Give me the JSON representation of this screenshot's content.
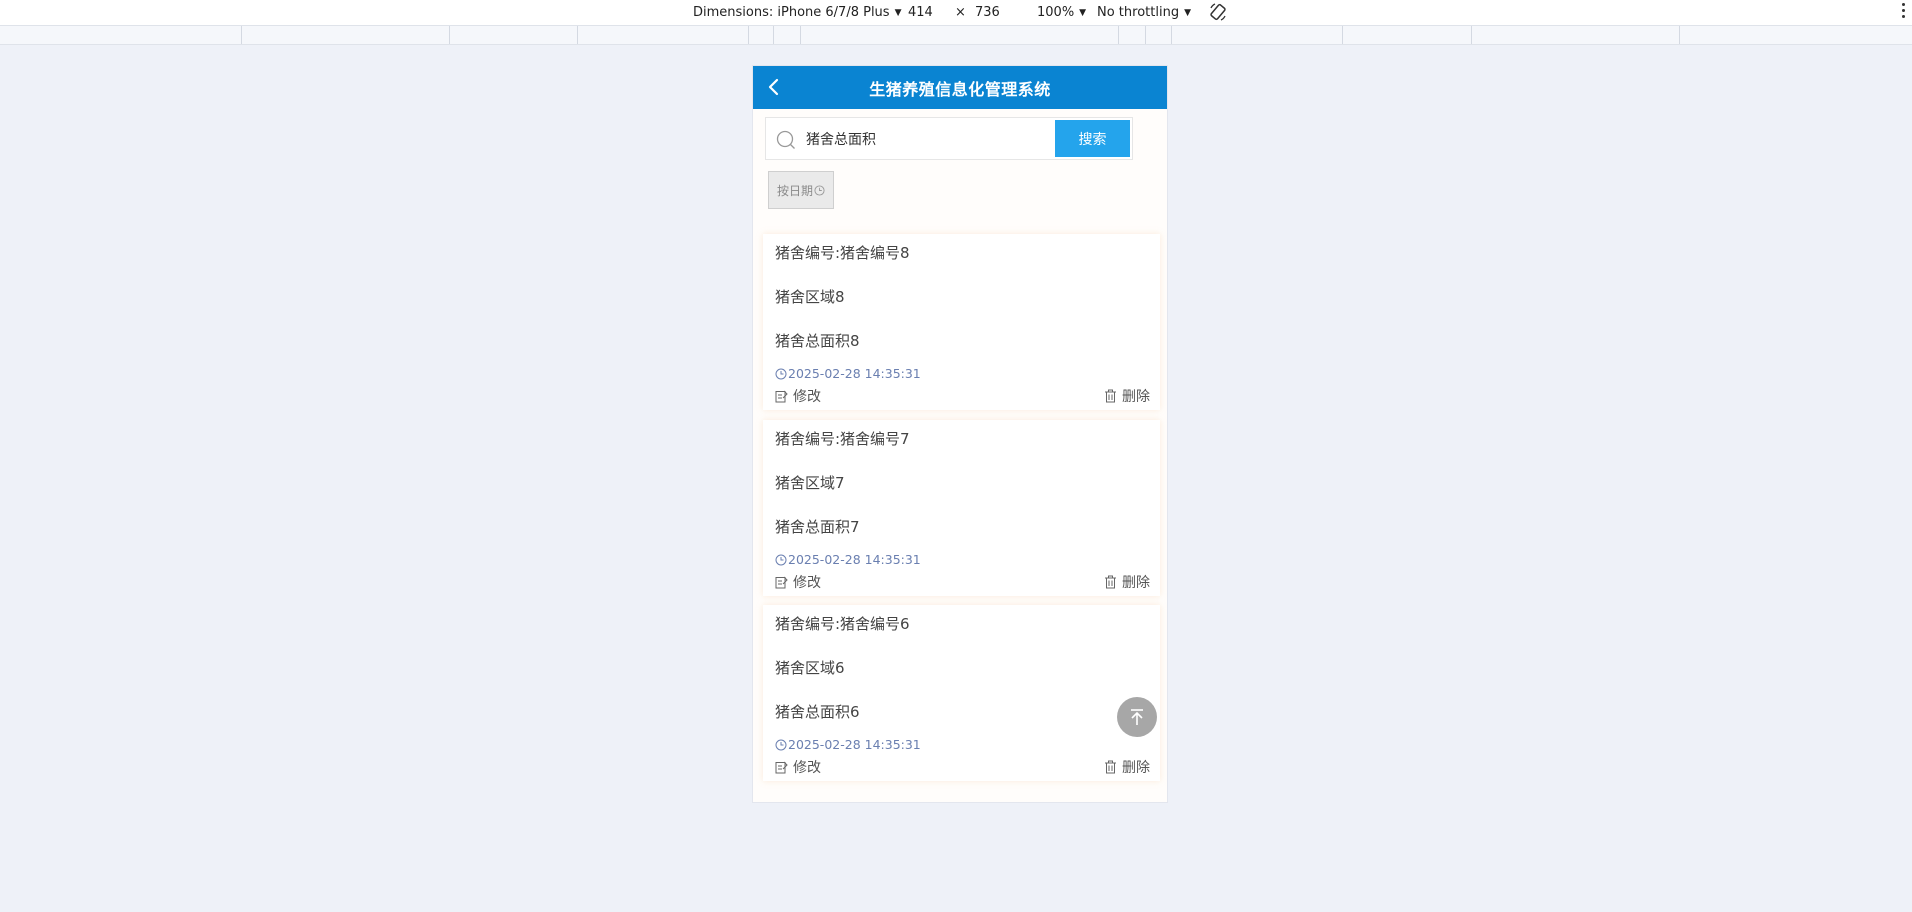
{
  "devtools": {
    "dimensions_label": "Dimensions: iPhone 6/7/8 Plus",
    "width": "414",
    "times": "×",
    "height": "736",
    "zoom": "100%",
    "throttling": "No throttling"
  },
  "header": {
    "title": "生猪养殖信息化管理系统"
  },
  "search": {
    "value": "猪舍总面积",
    "button_label": "搜索"
  },
  "filter": {
    "date_label": "按日期"
  },
  "records": [
    {
      "number": "猪舍编号:猪舍编号8",
      "area": "猪舍区域8",
      "total_area": "猪舍总面积8",
      "time": "2025-02-28 14:35:31",
      "edit_label": "修改",
      "delete_label": "删除"
    },
    {
      "number": "猪舍编号:猪舍编号7",
      "area": "猪舍区域7",
      "total_area": "猪舍总面积7",
      "time": "2025-02-28 14:35:31",
      "edit_label": "修改",
      "delete_label": "删除"
    },
    {
      "number": "猪舍编号:猪舍编号6",
      "area": "猪舍区域6",
      "total_area": "猪舍总面积6",
      "time": "2025-02-28 14:35:31",
      "edit_label": "修改",
      "delete_label": "删除"
    }
  ],
  "colors": {
    "header": "#0a84d2",
    "search_button": "#24a4ec",
    "time_text": "#6a7fb0"
  }
}
